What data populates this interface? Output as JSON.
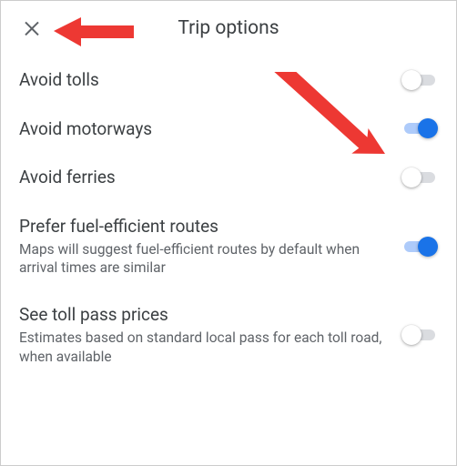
{
  "header": {
    "title": "Trip options"
  },
  "options": [
    {
      "id": "avoid-tolls",
      "title": "Avoid tolls",
      "subtitle": "",
      "on": false
    },
    {
      "id": "avoid-motorways",
      "title": "Avoid motorways",
      "subtitle": "",
      "on": true
    },
    {
      "id": "avoid-ferries",
      "title": "Avoid ferries",
      "subtitle": "",
      "on": false
    },
    {
      "id": "prefer-fuel-efficient",
      "title": "Prefer fuel-efficient routes",
      "subtitle": "Maps will suggest fuel-efficient routes by default when arrival times are similar",
      "on": true
    },
    {
      "id": "see-toll-pass-prices",
      "title": "See toll pass prices",
      "subtitle": "Estimates based on standard local pass for each toll road, when available",
      "on": false
    }
  ],
  "colors": {
    "accent": "#1a73e8",
    "arrow": "#ed3833"
  }
}
